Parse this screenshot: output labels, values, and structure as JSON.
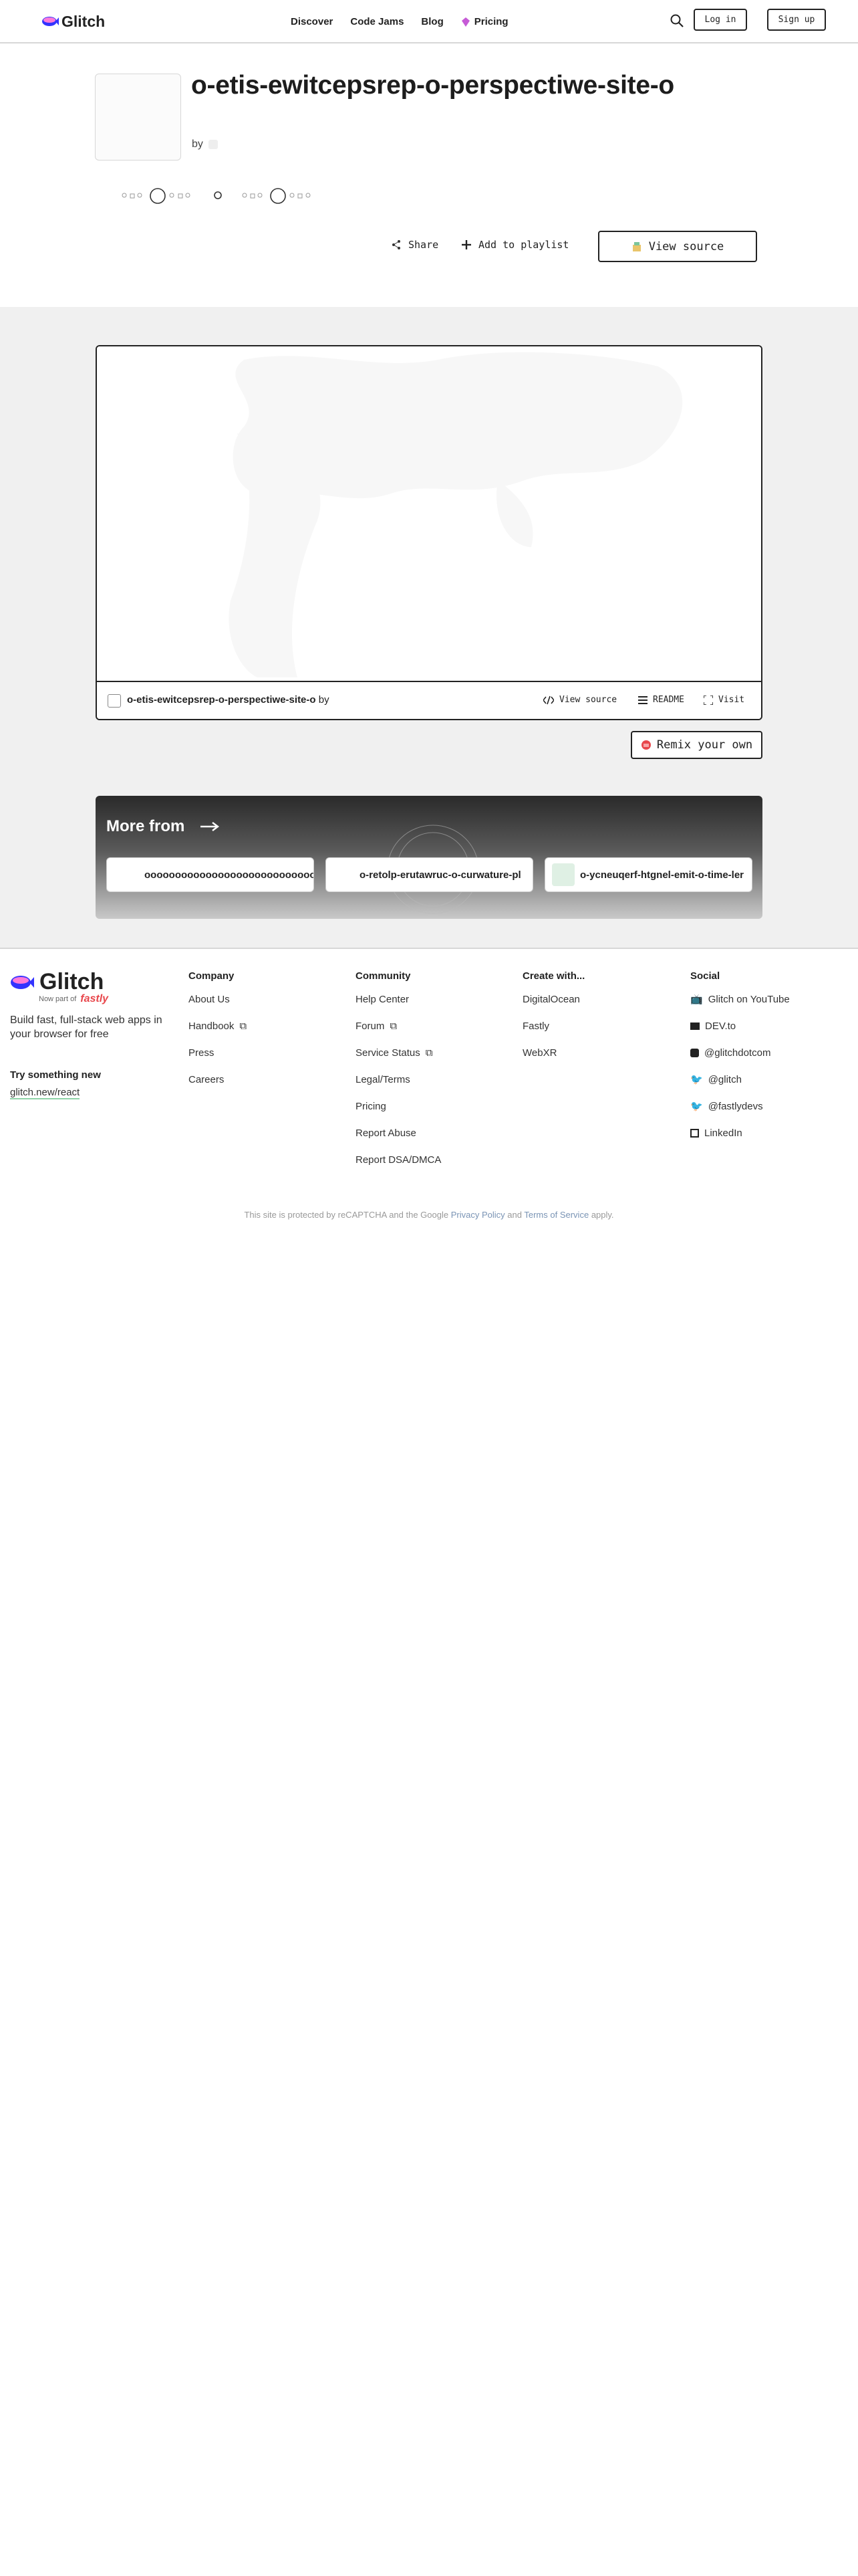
{
  "header": {
    "logo": "Glitch",
    "nav": [
      "Discover",
      "Code Jams",
      "Blog",
      "Pricing"
    ],
    "login": "Log in",
    "signup": "Sign up"
  },
  "project": {
    "title": "o-etis-ewitcepsrep-o-perspectiwe-site-o",
    "by": "by",
    "share": "Share",
    "add_playlist": "Add to playlist",
    "view_source": "View source"
  },
  "preview": {
    "name": "o-etis-ewitcepsrep-o-perspectiwe-site-o",
    "by": "by",
    "view_source": "View source",
    "readme": "README",
    "visit": "Visit"
  },
  "remix": "Remix your own",
  "more_from": {
    "title": "More from",
    "cards": [
      {
        "name": "oooooooooooooooooooooooooooooooooo"
      },
      {
        "name": "o-retolp-erutawruc-o-curwature-pl"
      },
      {
        "name": "o-ycneuqerf-htgnel-emit-o-time-ler"
      }
    ]
  },
  "footer": {
    "logo": "Glitch",
    "now_part_of": "Now part of",
    "fastly": "fastly",
    "tagline": "Build fast, full-stack web apps in your browser for free",
    "try_label": "Try something new",
    "try_link": "glitch.new/react",
    "columns": [
      {
        "title": "Company",
        "items": [
          "About Us",
          "Handbook",
          "Press",
          "Careers"
        ]
      },
      {
        "title": "Community",
        "items": [
          "Help Center",
          "Forum",
          "Service Status",
          "Legal/Terms",
          "Pricing",
          "Report Abuse",
          "Report DSA/DMCA"
        ]
      },
      {
        "title": "Create with...",
        "items": [
          "DigitalOcean",
          "Fastly",
          "WebXR"
        ]
      },
      {
        "title": "Social",
        "items": [
          "Glitch on YouTube",
          "DEV.to",
          "@glitchdotcom",
          "@glitch",
          "@fastlydevs",
          "LinkedIn"
        ]
      }
    ],
    "recaptcha_pre": "This site is protected by reCAPTCHA and the Google",
    "privacy": "Privacy Policy",
    "and": "and",
    "terms": "Terms of Service",
    "apply": "apply."
  },
  "colors": {
    "accent": "#e8474c",
    "pricing_gem": "#c65bd6",
    "grey_bg": "#f0f0f0"
  }
}
